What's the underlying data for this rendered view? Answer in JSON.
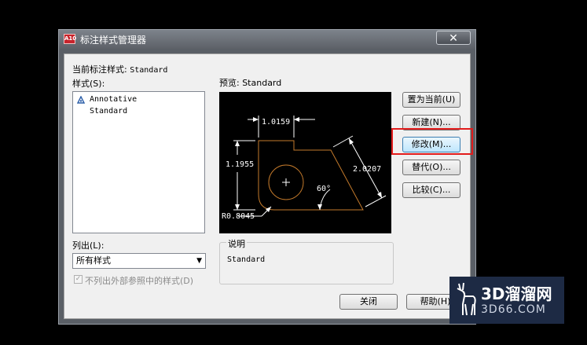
{
  "window": {
    "title": "标注样式管理器",
    "close_glyph": "✕",
    "app_icon_text": "A10"
  },
  "current_style": {
    "label": "当前标注样式:",
    "value": "Standard"
  },
  "styles": {
    "label": "样式(S):",
    "items": [
      "Annotative",
      "Standard"
    ]
  },
  "preview": {
    "label": "预览: Standard",
    "dims": {
      "top": "1.0159",
      "left": "1.1955",
      "right": "2.0207",
      "angle": "60°",
      "radius": "R0.8045"
    }
  },
  "buttons": {
    "set_current": "置为当前(U)",
    "new": "新建(N)...",
    "modify": "修改(M)...",
    "override": "替代(O)...",
    "compare": "比较(C)...",
    "close": "关闭",
    "help": "帮助(H)"
  },
  "list_filter": {
    "label": "列出(L):",
    "value": "所有样式"
  },
  "xref_checkbox": {
    "label": "不列出外部参照中的样式(D)",
    "checked": true
  },
  "description": {
    "label": "说明",
    "value": "Standard"
  },
  "watermark": {
    "main": "3D溜溜网",
    "sub": "3D66.COM"
  },
  "colors": {
    "highlight": "#e21b1b",
    "drawing": "#c47a2b",
    "dim_text": "#ffffff"
  }
}
